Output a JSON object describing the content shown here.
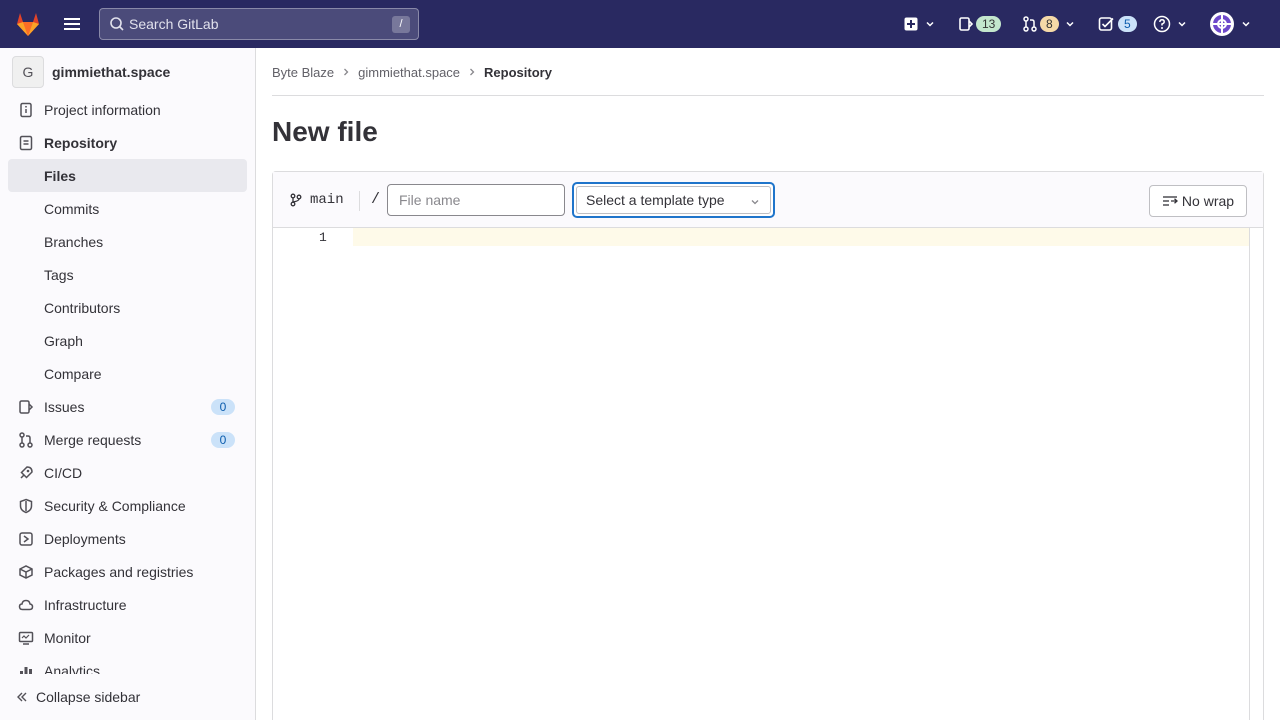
{
  "topbar": {
    "search_placeholder": "Search GitLab",
    "search_shortcut": "/",
    "issues_count": "13",
    "mr_count": "8",
    "todos_count": "5"
  },
  "sidebar": {
    "project_initial": "G",
    "project_name": "gimmiethat.space",
    "items": [
      {
        "label": "Project information",
        "icon": "info-icon"
      },
      {
        "label": "Repository",
        "icon": "document-icon"
      },
      {
        "label": "Files"
      },
      {
        "label": "Commits"
      },
      {
        "label": "Branches"
      },
      {
        "label": "Tags"
      },
      {
        "label": "Contributors"
      },
      {
        "label": "Graph"
      },
      {
        "label": "Compare"
      },
      {
        "label": "Issues",
        "icon": "issues-icon",
        "count": "0"
      },
      {
        "label": "Merge requests",
        "icon": "merge-request-icon",
        "count": "0"
      },
      {
        "label": "CI/CD",
        "icon": "rocket-icon"
      },
      {
        "label": "Security & Compliance",
        "icon": "shield-icon"
      },
      {
        "label": "Deployments",
        "icon": "deployments-icon"
      },
      {
        "label": "Packages and registries",
        "icon": "package-icon"
      },
      {
        "label": "Infrastructure",
        "icon": "cloud-icon"
      },
      {
        "label": "Monitor",
        "icon": "monitor-icon"
      },
      {
        "label": "Analytics",
        "icon": "chart-icon"
      }
    ],
    "collapse_label": "Collapse sidebar"
  },
  "breadcrumb": {
    "items": [
      "Byte Blaze",
      "gimmiethat.space",
      "Repository"
    ]
  },
  "page": {
    "title": "New file"
  },
  "editor": {
    "branch": "main",
    "path_separator": "/",
    "filename_placeholder": "File name",
    "template_select": "Select a template type",
    "wrap_button": "No wrap",
    "line_number": "1"
  },
  "colors": {
    "topbar_bg": "#292961",
    "issues_badge": "#c3e6cd",
    "mr_badge": "#f5d9a8",
    "todos_badge": "#cbe2f9",
    "focus_blue": "#1f75cb"
  }
}
